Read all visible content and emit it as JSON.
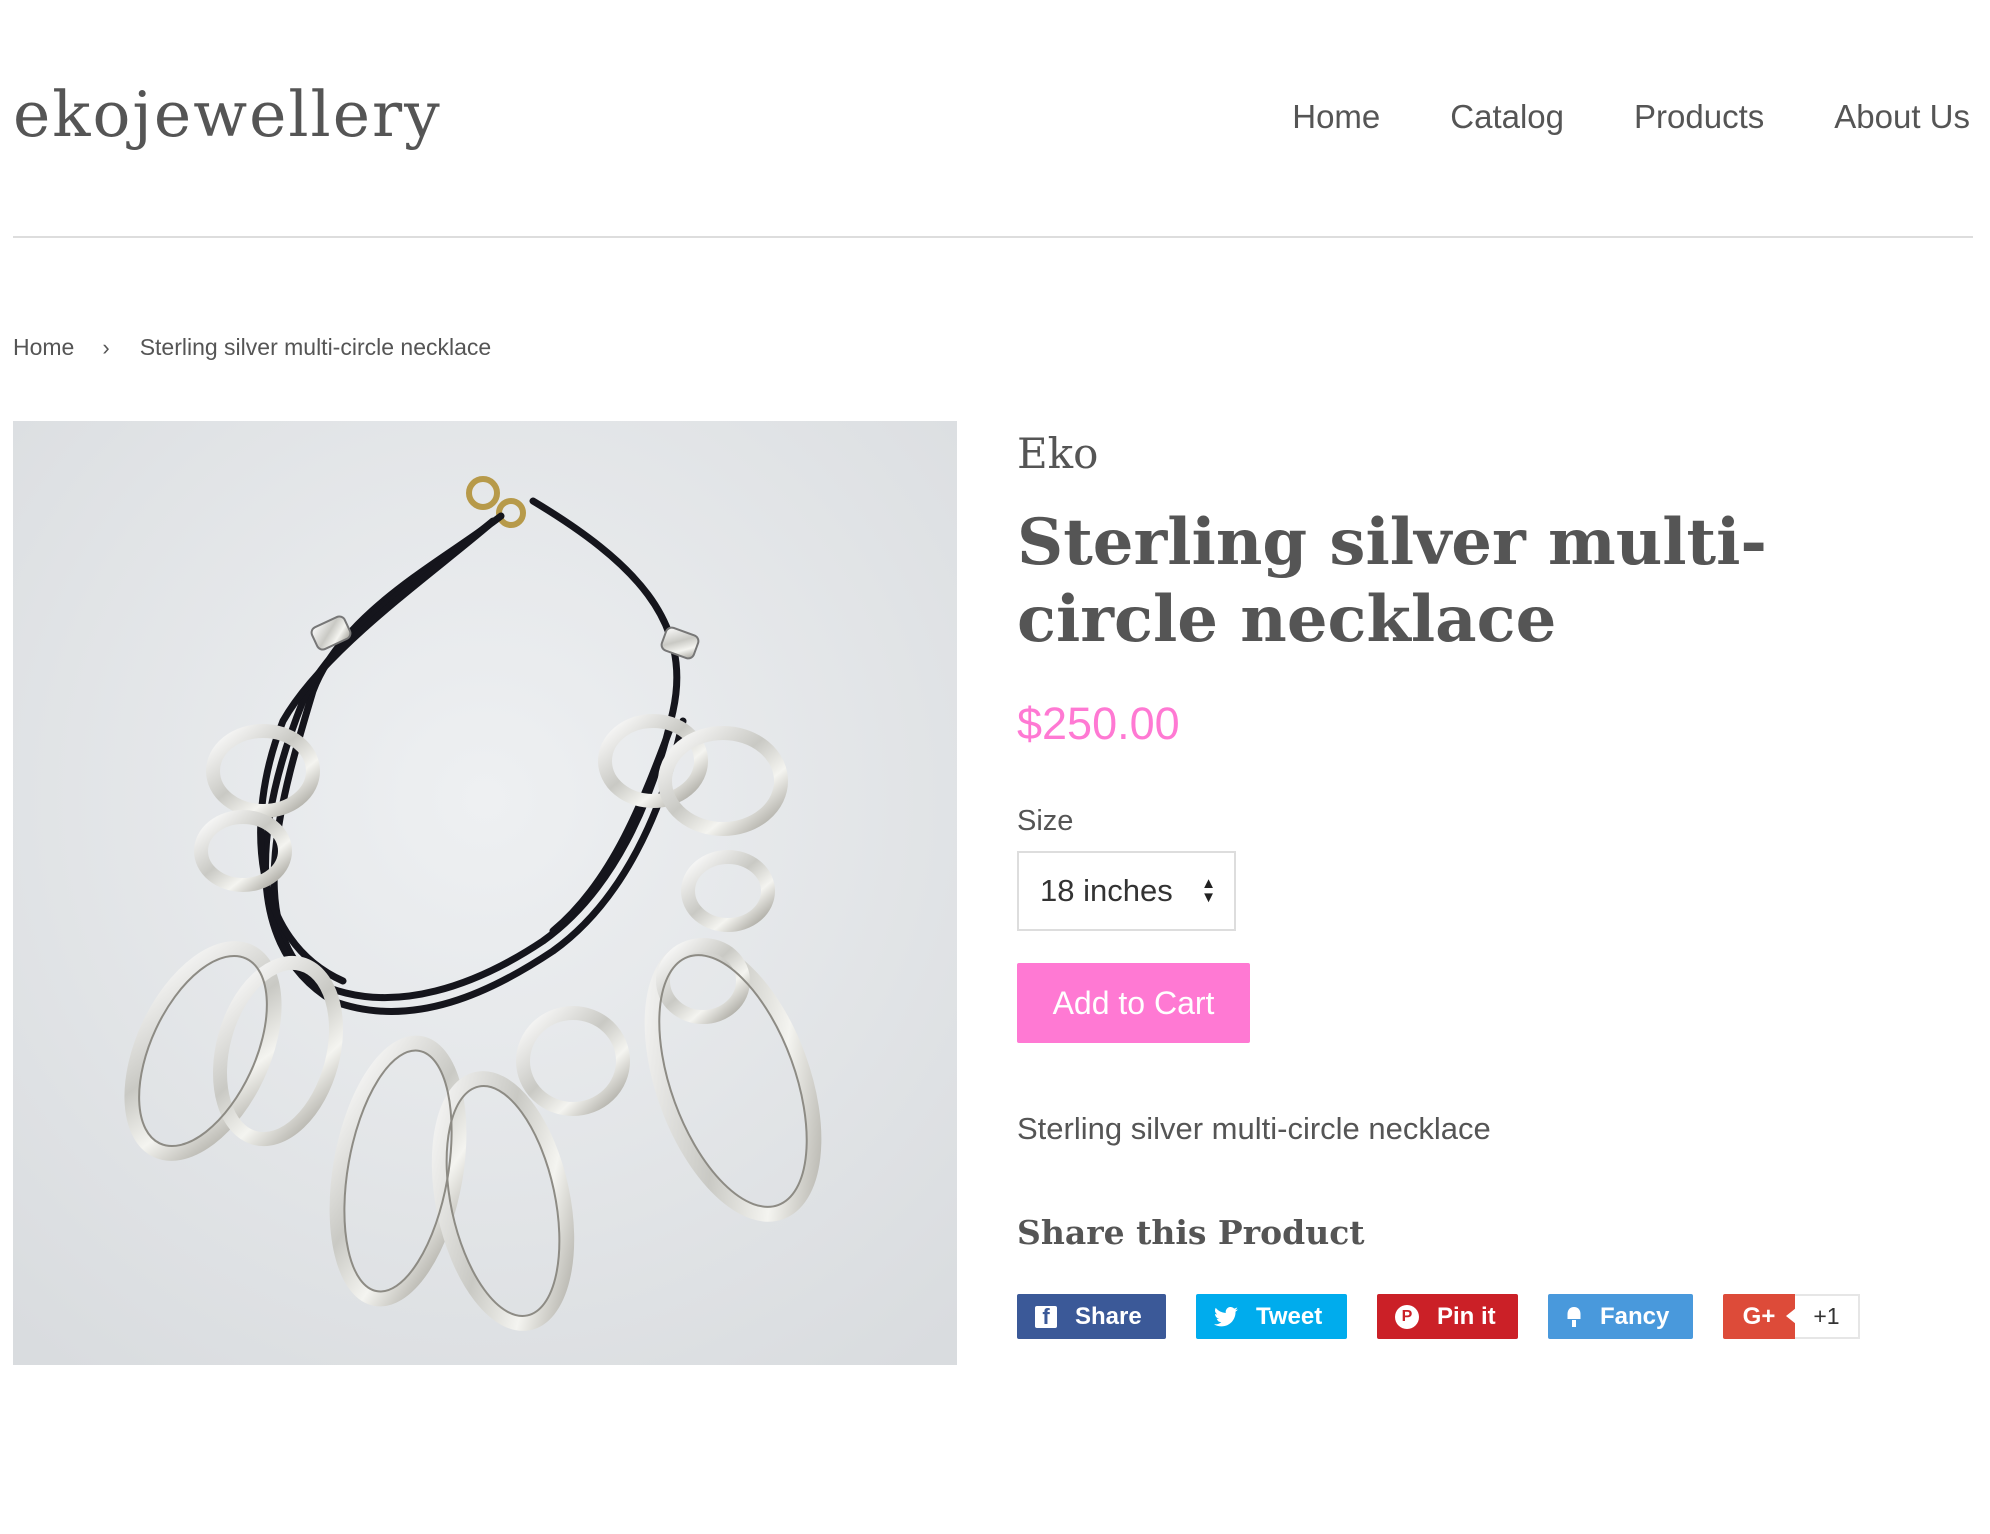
{
  "header": {
    "logo": "ekojewellery",
    "nav": [
      {
        "label": "Home"
      },
      {
        "label": "Catalog"
      },
      {
        "label": "Products"
      },
      {
        "label": "About Us"
      }
    ]
  },
  "breadcrumb": {
    "home": "Home",
    "separator": "›",
    "current": "Sterling silver multi-circle necklace"
  },
  "product": {
    "image_alt": "Sterling silver multi-circle necklace",
    "vendor": "Eko",
    "title": "Sterling silver multi-circle necklace",
    "price": "$250.00",
    "price_color": "#ff79d3",
    "size_label": "Size",
    "size_selected": "18 inches",
    "add_to_cart": "Add to Cart",
    "description": "Sterling silver multi-circle necklace"
  },
  "share": {
    "title": "Share this Product",
    "buttons": [
      {
        "label": "Share",
        "icon": "facebook-icon",
        "color": "#3b5998"
      },
      {
        "label": "Tweet",
        "icon": "twitter-icon",
        "color": "#00aced"
      },
      {
        "label": "Pin it",
        "icon": "pinterest-icon",
        "color": "#cb2027"
      },
      {
        "label": "Fancy",
        "icon": "fancy-icon",
        "color": "#4999dc"
      }
    ],
    "gplus": {
      "label": "G+",
      "count": "+1",
      "color": "#dd4b39"
    }
  }
}
